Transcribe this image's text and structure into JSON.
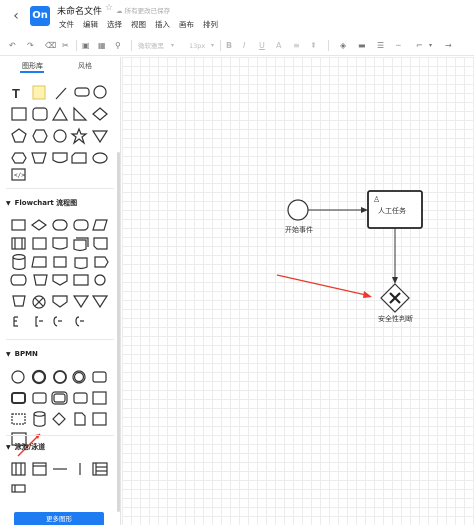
{
  "app": {
    "logo_text": "On",
    "doc_title": "未命名文件",
    "save_status": "所有更改已保存",
    "menu": [
      "文件",
      "编辑",
      "选择",
      "视图",
      "插入",
      "画布",
      "排列"
    ]
  },
  "toolbar": {
    "font_label": "微软雅黑",
    "size_label": "13px"
  },
  "sidebar": {
    "tabs": [
      "图形库",
      "风格"
    ],
    "sections": [
      {
        "title": "Flowchart 流程图"
      },
      {
        "title": "BPMN"
      },
      {
        "title": "泳池/泳道"
      }
    ],
    "more_button": "更多图形"
  },
  "canvas": {
    "start_label": "开始事件",
    "task_label": "人工任务",
    "gateway_label": "安全性判断"
  },
  "colors": {
    "accent": "#1e7cf2",
    "annotation_red": "#e8392c"
  }
}
